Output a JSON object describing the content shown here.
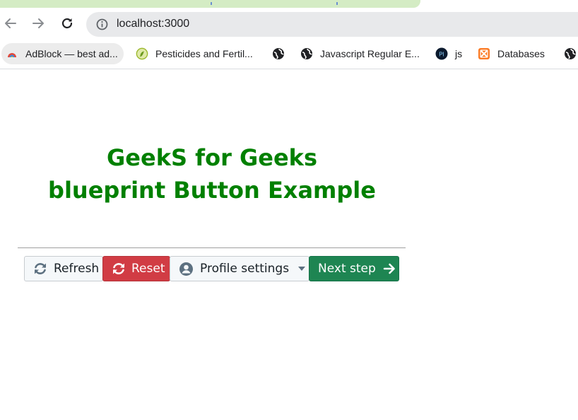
{
  "browser": {
    "url": "localhost:3000",
    "nav_icons": [
      "back-arrow-icon",
      "forward-arrow-icon",
      "reload-icon",
      "info-icon"
    ],
    "bookmarks": [
      {
        "label": "AdBlock — best ad...",
        "icon": "adblock-icon"
      },
      {
        "label": "Pesticides and Fertil...",
        "icon": "leaf-icon"
      },
      {
        "label": "",
        "icon": "globe-icon"
      },
      {
        "label": "Javascript Regular E...",
        "icon": "globe-icon"
      },
      {
        "label": "js",
        "icon": "pl-icon"
      },
      {
        "label": "Databases",
        "icon": "xampp-icon"
      },
      {
        "label": "",
        "icon": "globe-icon"
      }
    ]
  },
  "page": {
    "heading_line1": "GeekS for Geeks",
    "heading_line2": "blueprint Button Example",
    "heading_color": "#008000",
    "buttons": {
      "refresh": {
        "label": "Refresh",
        "icon": "refresh-icon"
      },
      "reset": {
        "label": "Reset",
        "icon": "refresh-icon",
        "color": "#d13c44"
      },
      "profile": {
        "label": "Profile settings",
        "icon": "user-icon",
        "caret": "caret-down-icon"
      },
      "next": {
        "label": "Next step",
        "icon": "arrow-right-icon",
        "color": "#1e8552"
      }
    }
  }
}
